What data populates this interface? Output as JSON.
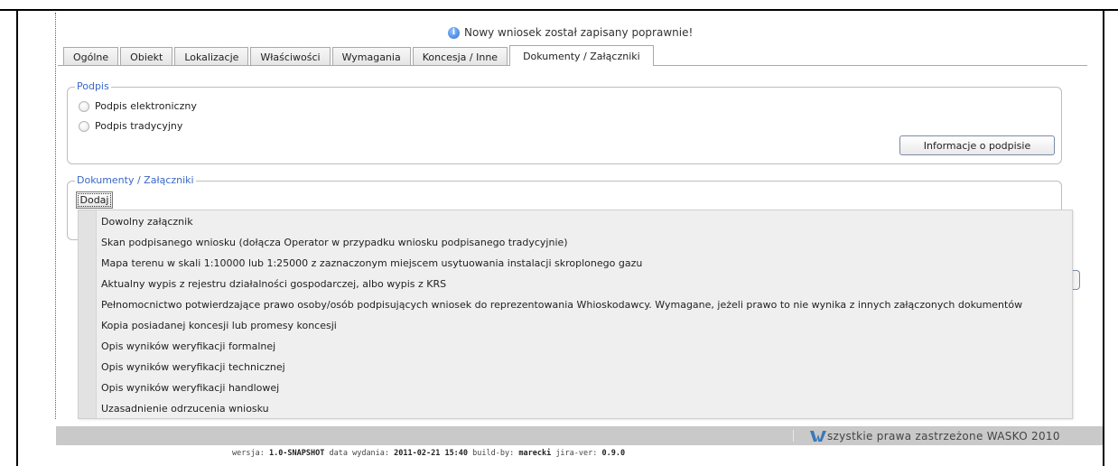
{
  "notice": {
    "text": "Nowy wniosek został zapisany poprawnie!"
  },
  "tabs": [
    {
      "label": "Ogólne"
    },
    {
      "label": "Obiekt"
    },
    {
      "label": "Lokalizacje"
    },
    {
      "label": "Właściwości"
    },
    {
      "label": "Wymagania"
    },
    {
      "label": "Koncesja / Inne"
    },
    {
      "label": "Dokumenty / Załączniki",
      "active": true
    }
  ],
  "podpis": {
    "legend": "Podpis",
    "options": [
      "Podpis elektroniczny",
      "Podpis tradycyjny"
    ],
    "info_button": "Informacje o podpisie"
  },
  "documents": {
    "legend": "Dokumenty / Załączniki",
    "add_button": "Dodaj"
  },
  "dropdown": {
    "items": [
      "Dowolny załącznik",
      "Skan podpisanego wniosku (dołącza Operator w przypadku wniosku podpisanego tradycyjnie)",
      "Mapa terenu w skali 1:10000 lub 1:25000 z zaznaczonym miejscem usytuowania instalacji skroplonego gazu",
      "Aktualny wypis z rejestru działalności gospodarczej, albo wypis z KRS",
      "Pełnomocnictwo potwierdzające prawo osoby/osób podpisujących wniosek do reprezentowania Whioskodawcy. Wymagane, jeżeli prawo to nie wynika z innych załączonych dokumentów",
      "Kopia posiadanej koncesji lub promesy koncesji",
      "Opis wyników weryfikacji formalnej",
      "Opis wyników weryfikacji technicznej",
      "Opis wyników weryfikacji handlowej",
      "Uzasadnienie odrzucenia wniosku"
    ]
  },
  "footer": {
    "copyright": "szystkie prawa zastrzeżone WASKO 2010",
    "version_label": "wersja:",
    "version": "1.0-SNAPSHOT",
    "date_label": "data wydania:",
    "date": "2011-02-21 15:40",
    "build_label": "build-by:",
    "build": "marecki",
    "jira_label": "jira-ver:",
    "jira": "0.9.0"
  },
  "colors": {
    "legend": "#3a67c6",
    "footer_bar": "#c9c9c9",
    "logo": "#3a78b8"
  }
}
